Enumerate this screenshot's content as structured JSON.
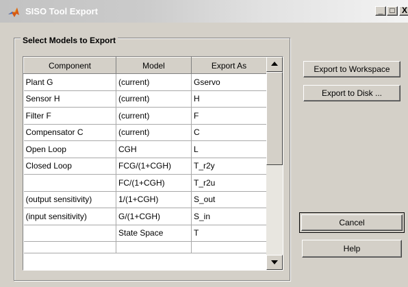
{
  "window": {
    "title": "SISO Tool Export",
    "controls": {
      "minimize_glyph": "_",
      "maximize_glyph": "□",
      "close_glyph": "X"
    }
  },
  "group": {
    "label": "Select Models to Export"
  },
  "table": {
    "columns": [
      "Component",
      "Model",
      "Export As"
    ],
    "rows": [
      {
        "component": "Plant G",
        "model": "(current)",
        "export_as": "Gservo"
      },
      {
        "component": "Sensor H",
        "model": "(current)",
        "export_as": "H"
      },
      {
        "component": "Filter F",
        "model": "(current)",
        "export_as": "F"
      },
      {
        "component": "Compensator C",
        "model": "(current)",
        "export_as": "C"
      },
      {
        "component": "Open Loop",
        "model": "CGH",
        "export_as": "L"
      },
      {
        "component": "Closed Loop",
        "model": "FCG/(1+CGH)",
        "export_as": "T_r2y"
      },
      {
        "component": "",
        "model": "FC/(1+CGH)",
        "export_as": "T_r2u"
      },
      {
        "component": "(output sensitivity)",
        "model": "1/(1+CGH)",
        "export_as": "S_out"
      },
      {
        "component": "(input sensitivity)",
        "model": "G/(1+CGH)",
        "export_as": "S_in"
      },
      {
        "component": "",
        "model": "State Space",
        "export_as": "T"
      },
      {
        "component": "",
        "model": "",
        "export_as": ""
      }
    ]
  },
  "buttons": {
    "export_workspace": "Export to Workspace",
    "export_disk": "Export to Disk ...",
    "cancel": "Cancel",
    "help": "Help"
  },
  "icons": {
    "app": "matlab-logo-icon",
    "scroll_up": "arrow-up-icon",
    "scroll_down": "arrow-down-icon"
  },
  "colors": {
    "face": "#d4d0c8",
    "title_text": "#ffffff"
  }
}
